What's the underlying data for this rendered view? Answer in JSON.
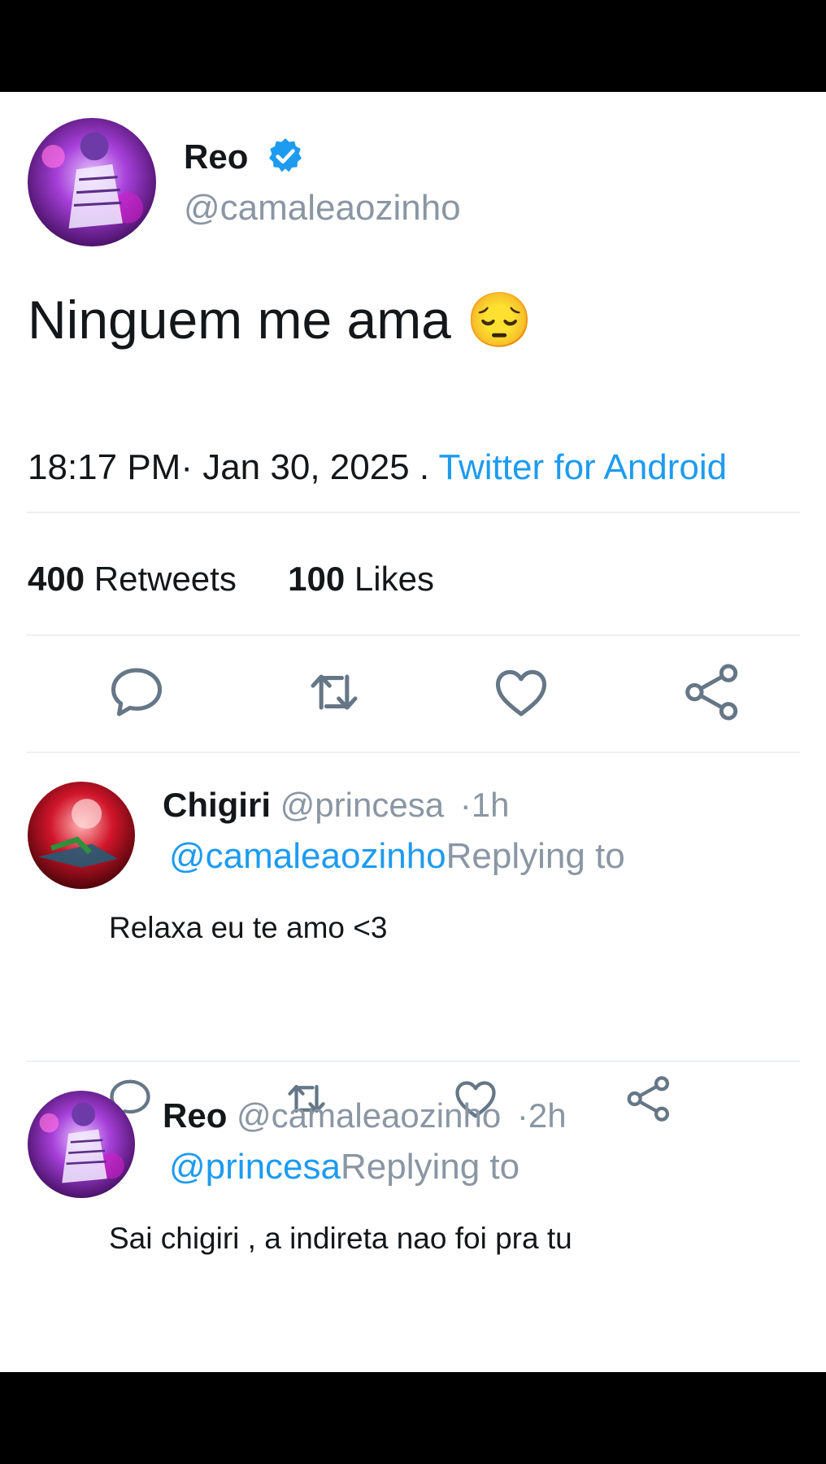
{
  "tweet": {
    "author_name": "Reo",
    "author_handle": "@camaleaozinho",
    "text": "Ninguem me ama",
    "emoji": "😔",
    "time_date": "18:17 PM· Jan 30, 2025 .",
    "source": "Twitter for Android",
    "retweets_count": "400",
    "retweets_label": "Retweets",
    "likes_count": "100",
    "likes_label": "Likes"
  },
  "replies": [
    {
      "name": "Chigiri",
      "handle": "@princesa",
      "time": "·1h",
      "mention": "@camaleaozinho",
      "replying_label": "Replying to",
      "text": "Relaxa eu te amo <3"
    },
    {
      "name": "Reo",
      "handle": "@camaleaozinho",
      "time": "·2h",
      "mention": "@princesa",
      "replying_label": "Replying to",
      "text": "Sai chigiri , a indireta nao foi pra tu"
    }
  ],
  "colors": {
    "accent": "#1d9bf0",
    "muted": "#8a96a3",
    "icon": "#657786",
    "text": "#14171a"
  },
  "icons": [
    "reply-icon",
    "retweet-icon",
    "like-icon",
    "share-icon",
    "verified-badge-icon"
  ]
}
